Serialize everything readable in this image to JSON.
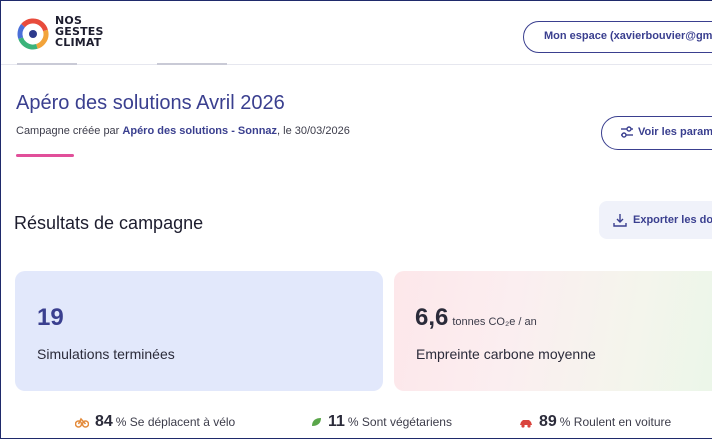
{
  "header": {
    "logo_lines": [
      "NOS",
      "GESTES",
      "CLIMAT"
    ],
    "account_label": "Mon espace (xavierbouvier@gmail..."
  },
  "campaign": {
    "title": "Apéro des solutions Avril 2026",
    "subtitle_prefix": "Campagne créée par ",
    "creator": "Apéro des solutions - Sonnaz",
    "subtitle_suffix": ", le 30/03/2026",
    "params_label": "Voir les param"
  },
  "results": {
    "title": "Résultats de campagne",
    "export_label": "Exporter les do"
  },
  "cards": {
    "simulations": {
      "value": "19",
      "label": "Simulations terminées"
    },
    "footprint": {
      "value": "6,6",
      "unit": "tonnes CO₂e / an",
      "label": "Empreinte carbone moyenne"
    }
  },
  "stats": [
    {
      "icon": "bike-icon",
      "value": "84",
      "text": "% Se déplacent à vélo",
      "color": "#e38a3a"
    },
    {
      "icon": "leaf-icon",
      "value": "11",
      "text": "% Sont végétariens",
      "color": "#5aa64a"
    },
    {
      "icon": "car-icon",
      "value": "89",
      "text": "% Roulent en voiture",
      "color": "#d9443d"
    }
  ],
  "colors": {
    "primary": "#3a3f8f",
    "accent_pink": "#e14f9a",
    "card_blue": "#e2e8fb"
  }
}
